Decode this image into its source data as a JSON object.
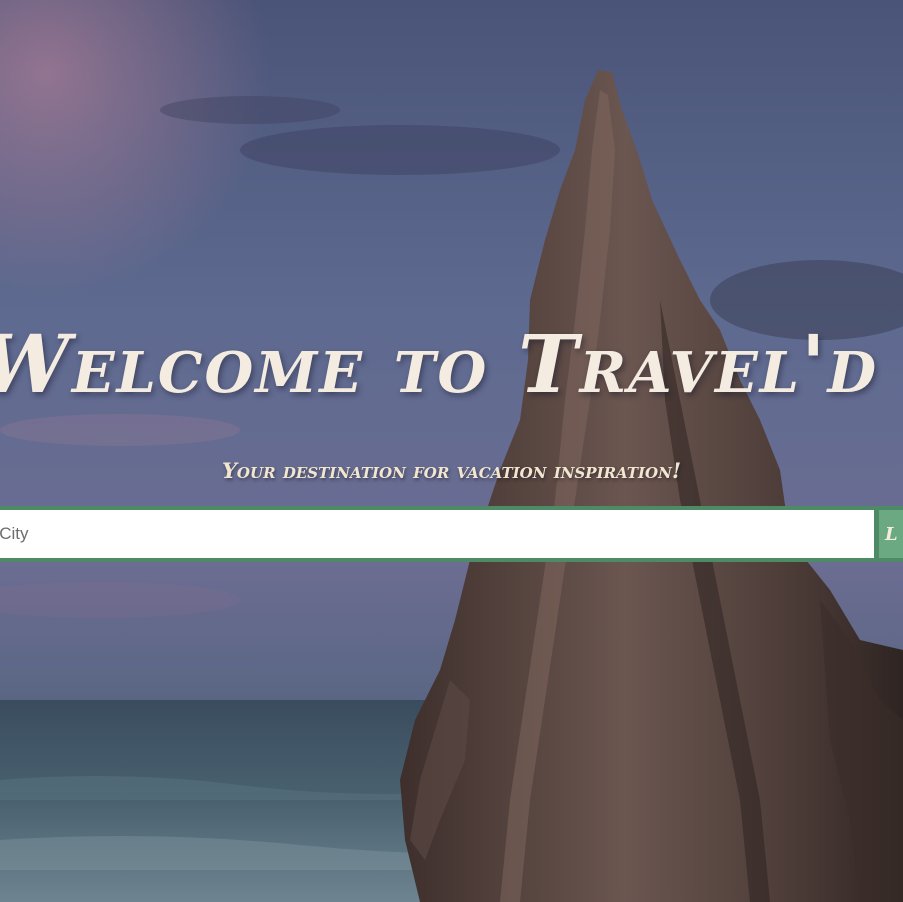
{
  "hero": {
    "title": "Welcome to Travel'd",
    "subtitle": "Your destination for vacation inspiration!"
  },
  "search": {
    "placeholder": "y City",
    "button_label": "L"
  },
  "colors": {
    "title_text": "#f4ece0",
    "search_accent": "#4f8a67",
    "search_button": "#6aa982"
  },
  "background": {
    "icon": "sea-stack-photo"
  }
}
